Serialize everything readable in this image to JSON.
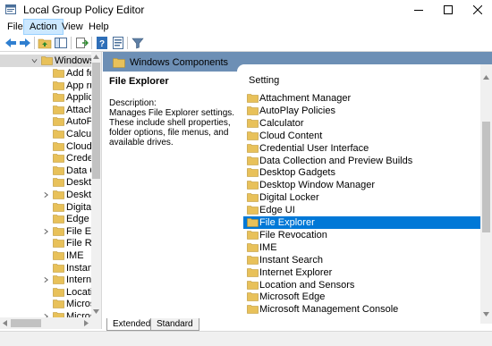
{
  "window": {
    "title": "Local Group Policy Editor",
    "icon": "gpedit-icon"
  },
  "menu": {
    "items": [
      "File",
      "Action",
      "View",
      "Help"
    ],
    "active": "Action"
  },
  "toolbar": {
    "icons": [
      "back-arrow-icon",
      "forward-arrow-icon",
      "up-folder-icon",
      "show-hide-tree-icon",
      "export-list-icon",
      "help-icon",
      "properties-icon",
      "filter-icon"
    ]
  },
  "tree": {
    "parent": "Windows C",
    "items": [
      {
        "label": "Add fe",
        "expandable": false
      },
      {
        "label": "App ru",
        "expandable": false
      },
      {
        "label": "Applic",
        "expandable": false
      },
      {
        "label": "Attach",
        "expandable": false
      },
      {
        "label": "AutoPl",
        "expandable": false
      },
      {
        "label": "Calcula",
        "expandable": false
      },
      {
        "label": "Cloud",
        "expandable": false
      },
      {
        "label": "Creder",
        "expandable": false
      },
      {
        "label": "Data C",
        "expandable": false
      },
      {
        "label": "Deskto",
        "expandable": false
      },
      {
        "label": "Deskto",
        "expandable": true
      },
      {
        "label": "Digital",
        "expandable": false
      },
      {
        "label": "Edge U",
        "expandable": false
      },
      {
        "label": "File Ex",
        "expandable": true
      },
      {
        "label": "File Re",
        "expandable": false
      },
      {
        "label": "IME",
        "expandable": false
      },
      {
        "label": "Instant",
        "expandable": false
      },
      {
        "label": "Interne",
        "expandable": true
      },
      {
        "label": "Locatio",
        "expandable": false
      },
      {
        "label": "Micros",
        "expandable": false
      },
      {
        "label": "Micros",
        "expandable": true
      },
      {
        "label": "Micros",
        "expandable": false
      }
    ]
  },
  "header": {
    "title": "Windows Components"
  },
  "description": {
    "title": "File Explorer",
    "label": "Description:",
    "text": "Manages File Explorer settings. These include shell properties, folder options, file menus, and available drives."
  },
  "list": {
    "column": "Setting",
    "items": [
      "Attachment Manager",
      "AutoPlay Policies",
      "Calculator",
      "Cloud Content",
      "Credential User Interface",
      "Data Collection and Preview Builds",
      "Desktop Gadgets",
      "Desktop Window Manager",
      "Digital Locker",
      "Edge UI",
      "File Explorer",
      "File Revocation",
      "IME",
      "Instant Search",
      "Internet Explorer",
      "Location and Sensors",
      "Microsoft Edge",
      "Microsoft Management Console"
    ],
    "selected": "File Explorer"
  },
  "tabs": {
    "extended": "Extended",
    "standard": "Standard",
    "active": "Extended"
  },
  "colors": {
    "header_bg": "#6d8fb5",
    "selection": "#0078d7",
    "folder": "#e8c15a"
  }
}
